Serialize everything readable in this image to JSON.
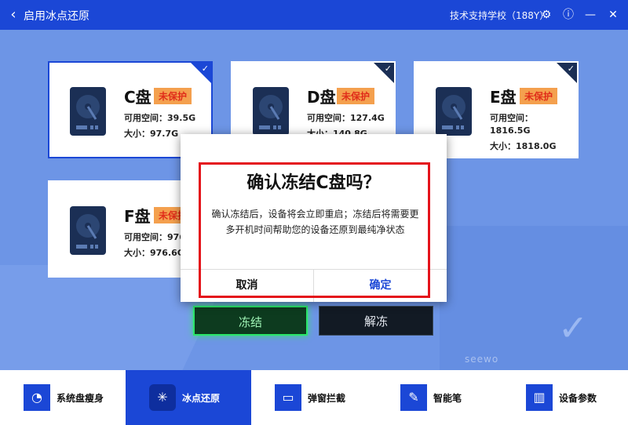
{
  "titlebar": {
    "back_icon": "chevron-left-icon",
    "title": "启用冰点还原",
    "support": "技术支持学校（188Y）",
    "gear": "⚙",
    "info": "ⓘ",
    "minimize": "—",
    "close": "✕"
  },
  "disks": [
    {
      "name": "C盘",
      "status": "未保护",
      "free_label": "可用空间：39.5G",
      "size_label": "大小：97.7G",
      "selected": true
    },
    {
      "name": "D盘",
      "status": "未保护",
      "free_label": "可用空间：127.4G",
      "size_label": "大小：140.8G",
      "selected": false
    },
    {
      "name": "E盘",
      "status": "未保护",
      "free_label": "可用空间：",
      "free_value": "1816.5G",
      "size_label": "大小：1818.0G",
      "selected": false
    },
    {
      "name": "F盘",
      "status": "未保护",
      "free_label": "可用空间：976",
      "size_label": "大小：976.6G",
      "selected": false
    }
  ],
  "dialog": {
    "title": "确认冻结C盘吗？",
    "message": "确认冻结后，设备将会立即重启；冻结后将需要更多开机时间帮助您的设备还原到最纯净状态",
    "cancel": "取消",
    "ok": "确定"
  },
  "actions": {
    "freeze": "冻结",
    "unfreeze": "解冻"
  },
  "brand": "seewo",
  "bottom_nav": [
    {
      "label": "系统盘瘦身",
      "icon": "disk-clean-icon",
      "active": false
    },
    {
      "label": "冰点还原",
      "icon": "snowflake-icon",
      "active": true
    },
    {
      "label": "弹窗拦截",
      "icon": "popup-block-icon",
      "active": false
    },
    {
      "label": "智能笔",
      "icon": "smart-pen-icon",
      "active": false
    },
    {
      "label": "设备参数",
      "icon": "device-params-icon",
      "active": false
    }
  ],
  "colors": {
    "accent": "#1b47d6",
    "badge_bg": "#f4a04e",
    "badge_text": "#e02d1a",
    "highlight": "#e4131b",
    "freeze_glow": "#2ae66a"
  }
}
